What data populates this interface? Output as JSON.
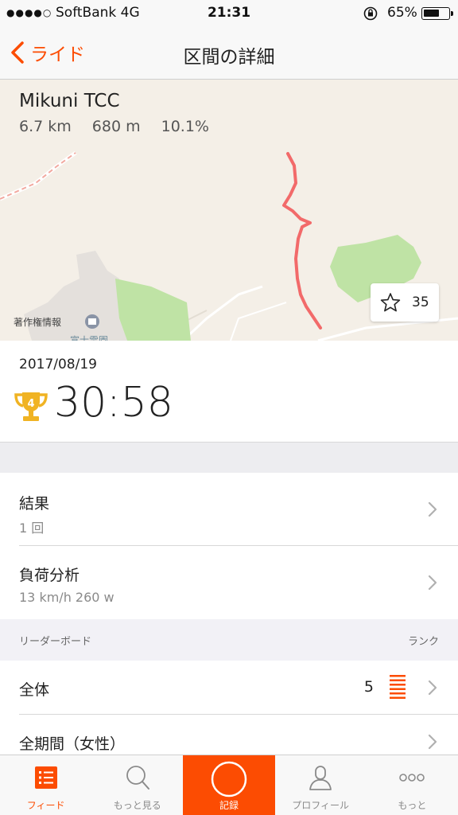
{
  "status_bar": {
    "signal": "●●●●○",
    "carrier": "SoftBank  4G",
    "time": "21:31",
    "battery": "65%",
    "battery_level": 0.65
  },
  "nav": {
    "back_label": "ライド",
    "title": "区間の詳細"
  },
  "segment": {
    "name": "Mikuni TCC",
    "distance": "6.7 km",
    "elevation": "680 m",
    "grade": "10.1%",
    "map_copyright": "著作権情報",
    "star_count": "35"
  },
  "effort": {
    "date": "2017/08/19",
    "rank": "4",
    "time": "30:58"
  },
  "results": {
    "label": "結果",
    "sub": "1 回"
  },
  "power": {
    "label": "負荷分析",
    "sub": "13 km/h 260 w"
  },
  "leaderboard": {
    "header": "リーダーボード",
    "rank_header": "ランク",
    "overall_label": "全体",
    "overall_rank": "5",
    "women_label": "全期間（女性）"
  },
  "tabs": [
    {
      "label": "フィード",
      "icon": "feed-icon"
    },
    {
      "label": "もっと見る",
      "icon": "search-icon"
    },
    {
      "label": "記録",
      "icon": "record-icon"
    },
    {
      "label": "プロフィール",
      "icon": "profile-icon"
    },
    {
      "label": "もっと",
      "icon": "more-icon"
    }
  ],
  "colors": {
    "accent": "#fc4c02",
    "route": "#f26a6a",
    "park": "#bfe3a5",
    "trophy": "#f0b323"
  }
}
